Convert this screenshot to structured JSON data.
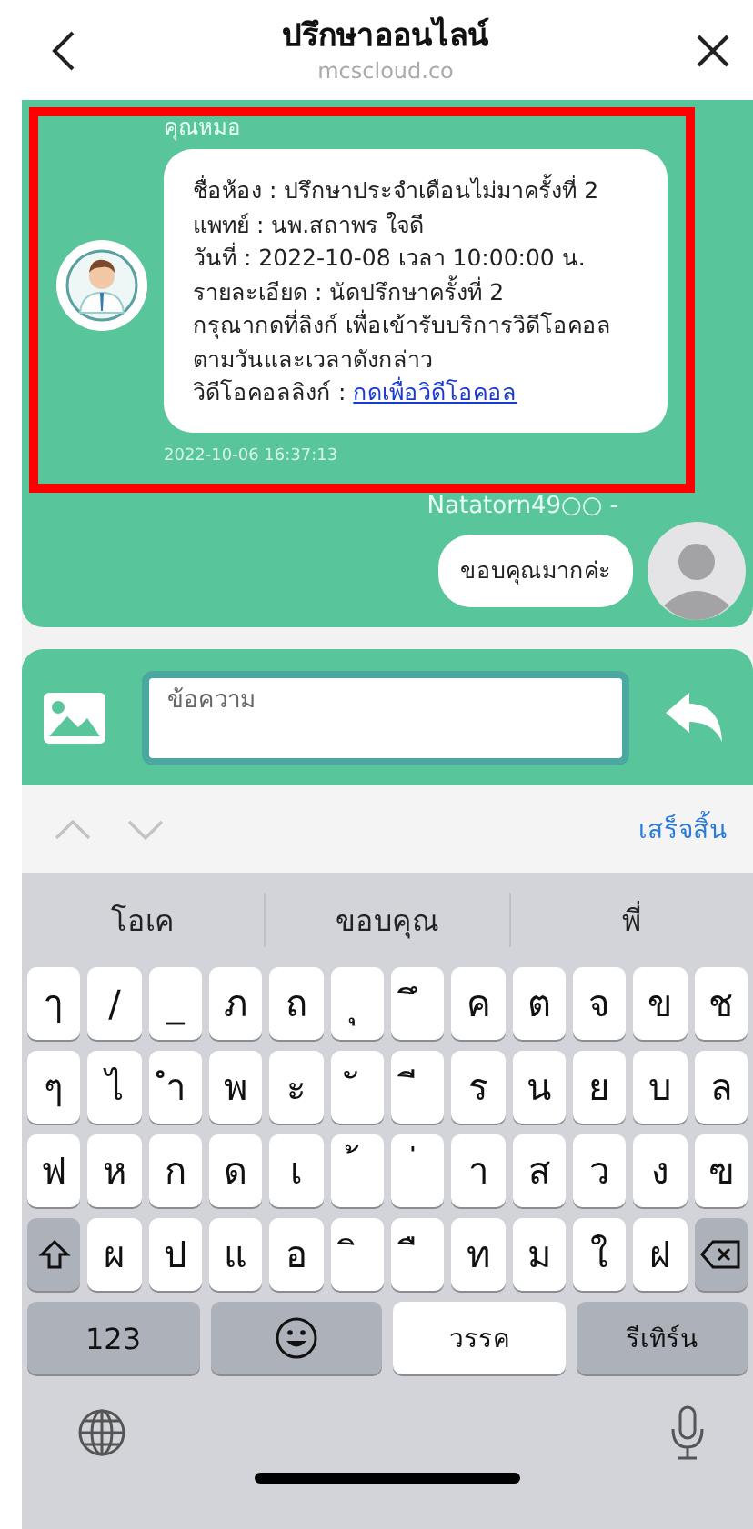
{
  "header": {
    "title": "ปรึกษาออนไลน์",
    "subtitle": "mcscloud.co"
  },
  "chat": {
    "messages": [
      {
        "kind": "incoming",
        "sender": "คุณหมอ",
        "highlighted": true,
        "lines": [
          "ชื่อห้อง : ปรึกษาประจำเดือนไม่มาครั้งที่ 2",
          "แพทย์ : นพ.สถาพร ใจดี",
          "วันที่ : 2022-10-08 เวลา 10:00:00 น.",
          "รายละเอียด : นัดปรึกษาครั้งที่ 2",
          "กรุณากดที่ลิงก์ เพื่อเข้ารับบริการวิดีโอคอล ตามวันและเวลาดังกล่าว"
        ],
        "link_label": "วิดีโอคอลลิงก์ :",
        "link_text": "กดเพื่อวิดีโอคอล",
        "time": "2022-10-06 16:37:13"
      },
      {
        "kind": "outgoing",
        "sender": "Natatorn49○○ -",
        "text": "ขอบคุณมากค่ะ"
      }
    ]
  },
  "composer": {
    "placeholder": "ข้อความ"
  },
  "toolbar": {
    "done": "เสร็จสิ้น"
  },
  "keyboard": {
    "suggestions": [
      "โอเค",
      "ขอบคุณ",
      "พี่"
    ],
    "rows": [
      [
        "ๅ",
        "/",
        "_",
        "ภ",
        "ถ",
        "ุ",
        "ึ",
        "ค",
        "ต",
        "จ",
        "ข",
        "ช"
      ],
      [
        "ๆ",
        "ไ",
        "ำ",
        "พ",
        "ะ",
        "ั",
        "ี",
        "ร",
        "น",
        "ย",
        "บ",
        "ล"
      ],
      [
        "ฟ",
        "ห",
        "ก",
        "ด",
        "เ",
        "้",
        "่",
        "า",
        "ส",
        "ว",
        "ง",
        "ฃ"
      ]
    ],
    "shift_row": [
      "ผ",
      "ป",
      "แ",
      "อ",
      "ิ",
      "ื",
      "ท",
      "ม",
      "ใ",
      "ฝ"
    ],
    "numbers": "123",
    "space": "วรรค",
    "return": "รีเทิร์น"
  }
}
